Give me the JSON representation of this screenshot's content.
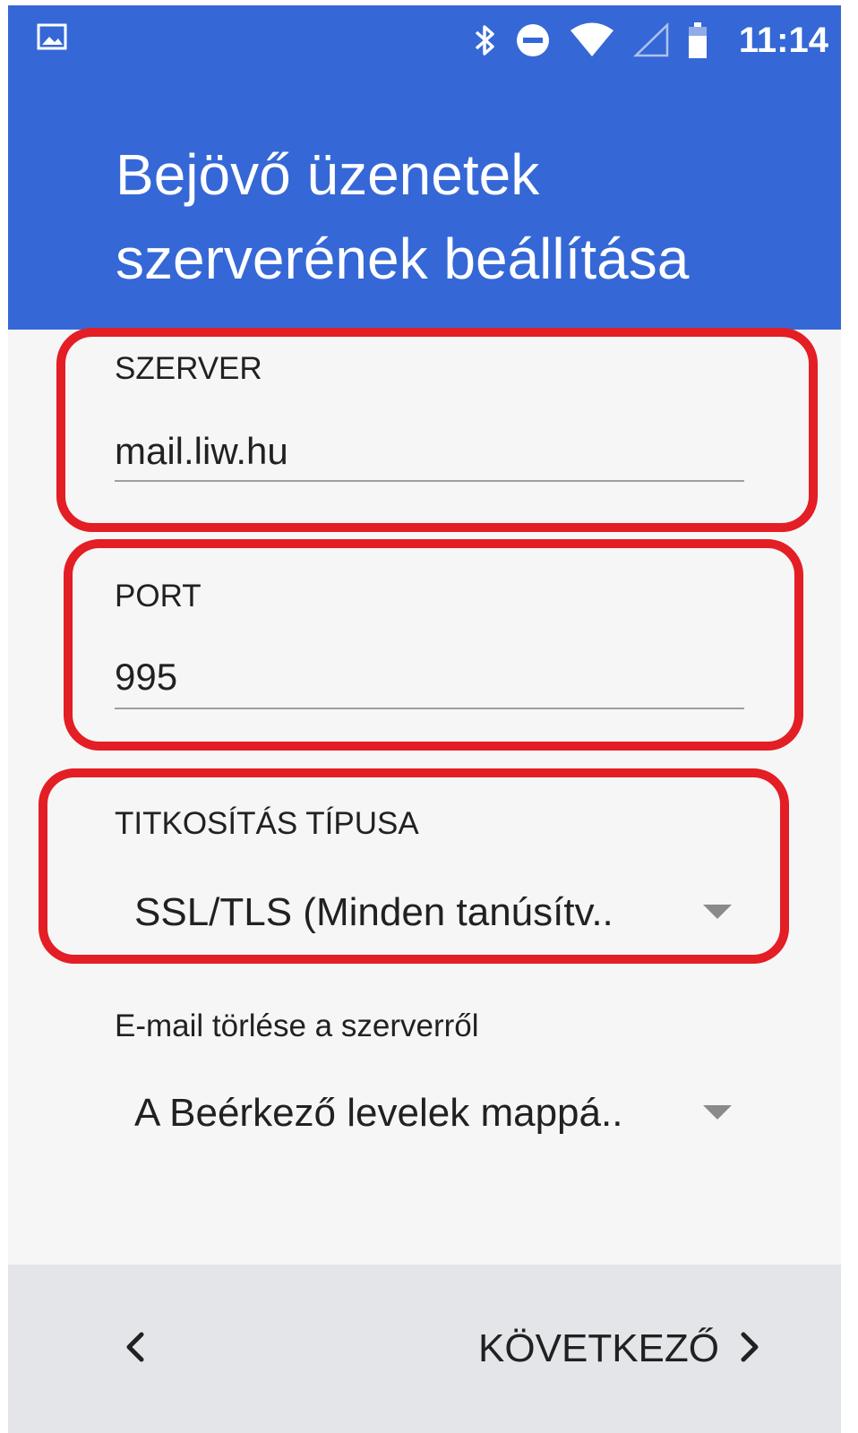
{
  "status_bar": {
    "time": "11:14",
    "icons": [
      "image-thumbnail-icon",
      "bluetooth-icon",
      "do-not-disturb-icon",
      "wifi-icon",
      "cell-signal-icon",
      "battery-icon"
    ]
  },
  "header": {
    "title": "Bejövő üzenetek szerverének beállítása"
  },
  "form": {
    "server": {
      "label": "SZERVER",
      "value": "mail.liw.hu"
    },
    "port": {
      "label": "PORT",
      "value": "995"
    },
    "security": {
      "label": "TITKOSÍTÁS TÍPUSA",
      "selected": "SSL/TLS (Minden tanúsítv.."
    },
    "delete_policy": {
      "label": "E-mail törlése a szerverről",
      "selected": "A Beérkező levelek mappá.."
    }
  },
  "navigation": {
    "next_label": "KÖVETKEZŐ"
  },
  "colors": {
    "app_bar": "#3568d6",
    "highlight": "#e31e24",
    "background": "#f6f6f6",
    "bottom_bar": "#e3e5e8"
  }
}
